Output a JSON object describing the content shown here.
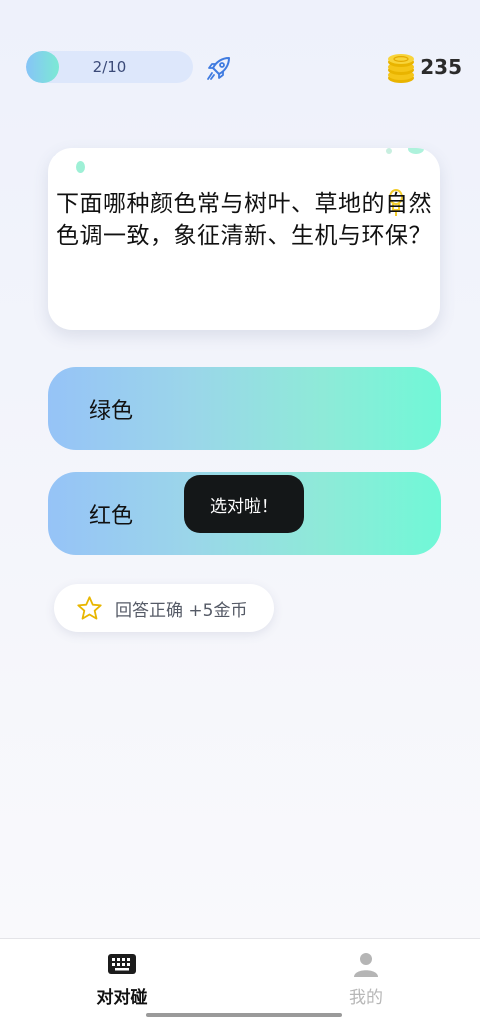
{
  "header": {
    "progress": {
      "text": "2/10",
      "current": 2,
      "total": 10
    },
    "rocket_icon": "rocket-icon",
    "coins": {
      "icon": "coins-stack-icon",
      "count": "235"
    }
  },
  "question": {
    "text": "下面哪种颜色常与树叶、草地的自然色调一致，象征清新、生机与环保？"
  },
  "options": [
    {
      "label": "绿色"
    },
    {
      "label": "红色"
    }
  ],
  "toast": {
    "text": "选对啦！"
  },
  "reward": {
    "icon": "star-icon",
    "text": "回答正确 +5金币"
  },
  "bottom_nav": {
    "items": [
      {
        "label": "对对碰",
        "icon": "keyboard-icon",
        "active": true
      },
      {
        "label": "我的",
        "icon": "person-icon",
        "active": false
      }
    ]
  },
  "colors": {
    "option_gradient_start": "#96c3f7",
    "option_gradient_end": "#70f8d7",
    "toast_bg": "#141718",
    "coin_gold": "#f5c518",
    "rocket_blue": "#3f7be0"
  }
}
